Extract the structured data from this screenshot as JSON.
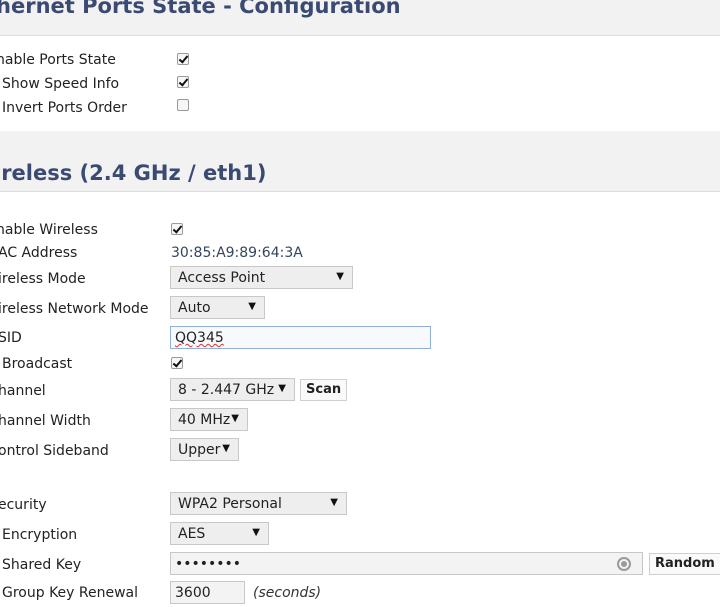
{
  "ethernet": {
    "title": "thernet Ports State - Configuration",
    "rows": {
      "enable": {
        "label": "nable Ports State",
        "checked": true
      },
      "speed": {
        "label": "Show Speed Info",
        "checked": true
      },
      "invert": {
        "label": "Invert Ports Order",
        "checked": false
      }
    }
  },
  "wireless": {
    "title": "ireless (2.4 GHz / eth1)",
    "enable": {
      "label": "nable Wireless",
      "checked": true
    },
    "mac": {
      "label": "AC Address",
      "value": "30:85:A9:89:64:3A"
    },
    "mode": {
      "label": "ireless Mode",
      "value": "Access Point"
    },
    "net_mode": {
      "label": "ireless Network Mode",
      "value": "Auto"
    },
    "ssid": {
      "label": "SID",
      "value": "QQ345"
    },
    "broadcast": {
      "label": "Broadcast",
      "checked": true
    },
    "channel": {
      "label": "hannel",
      "value": "8 - 2.447 GHz",
      "scan_label": "Scan"
    },
    "width": {
      "label": "hannel Width",
      "value": "40 MHz"
    },
    "sideband": {
      "label": "ontrol Sideband",
      "value": "Upper"
    },
    "security": {
      "label": "ecurity",
      "value": "WPA2 Personal"
    },
    "encryption": {
      "label": "Encryption",
      "value": "AES"
    },
    "shared_key": {
      "label": "Shared Key",
      "value": "••••••••",
      "random_label": "Random"
    },
    "renewal": {
      "label": "Group Key Renewal",
      "value": "3600",
      "unit": "(seconds)"
    }
  },
  "icons": {
    "checkbox": "checkmark-icon",
    "dropdown": "triangle-down-icon",
    "reveal": "eye-icon"
  }
}
